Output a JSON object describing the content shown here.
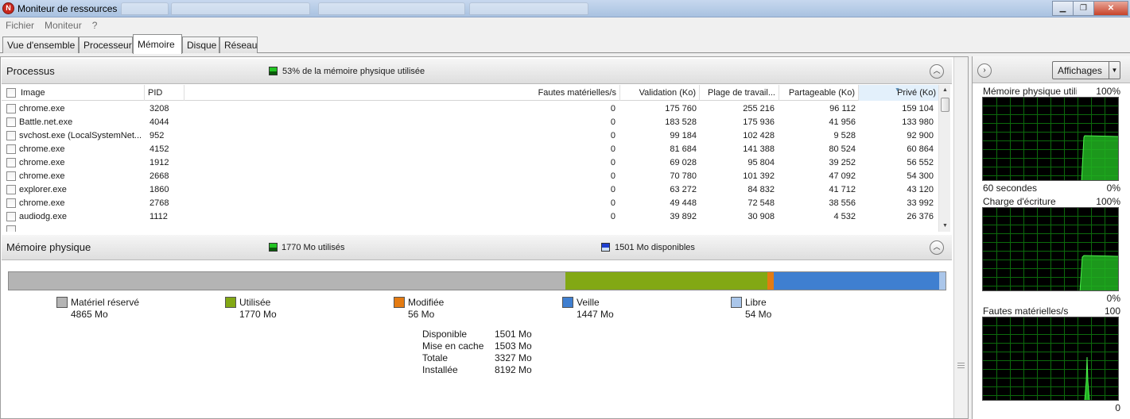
{
  "window": {
    "title": "Moniteur de ressources",
    "app_icon": "resource-monitor-icon",
    "controls": [
      "minimize",
      "restore",
      "close"
    ]
  },
  "menu": [
    "Fichier",
    "Moniteur",
    "?"
  ],
  "tabs": [
    {
      "label": "Vue d'ensemble",
      "active": false
    },
    {
      "label": "Processeur",
      "active": false
    },
    {
      "label": "Mémoire",
      "active": true
    },
    {
      "label": "Disque",
      "active": false
    },
    {
      "label": "Réseau",
      "active": false
    }
  ],
  "processes": {
    "title": "Processus",
    "usage_text": "53% de la mémoire physique utilisée",
    "usage_color": "#22c422",
    "columns": [
      "Image",
      "PID",
      "Fautes matérielles/s",
      "Validation (Ko)",
      "Plage de travail...",
      "Partageable (Ko)",
      "Privé (Ko)"
    ],
    "sorted_column": "Privé (Ko)",
    "rows": [
      {
        "image": "chrome.exe",
        "pid": "3208",
        "faults": "0",
        "commit": "175 760",
        "working_set": "255 216",
        "shareable": "96 112",
        "private": "159 104"
      },
      {
        "image": "Battle.net.exe",
        "pid": "4044",
        "faults": "0",
        "commit": "183 528",
        "working_set": "175 936",
        "shareable": "41 956",
        "private": "133 980"
      },
      {
        "image": "svchost.exe (LocalSystemNet...",
        "pid": "952",
        "faults": "0",
        "commit": "99 184",
        "working_set": "102 428",
        "shareable": "9 528",
        "private": "92 900"
      },
      {
        "image": "chrome.exe",
        "pid": "4152",
        "faults": "0",
        "commit": "81 684",
        "working_set": "141 388",
        "shareable": "80 524",
        "private": "60 864"
      },
      {
        "image": "chrome.exe",
        "pid": "1912",
        "faults": "0",
        "commit": "69 028",
        "working_set": "95 804",
        "shareable": "39 252",
        "private": "56 552"
      },
      {
        "image": "chrome.exe",
        "pid": "2668",
        "faults": "0",
        "commit": "70 780",
        "working_set": "101 392",
        "shareable": "47 092",
        "private": "54 300"
      },
      {
        "image": "explorer.exe",
        "pid": "1860",
        "faults": "0",
        "commit": "63 272",
        "working_set": "84 832",
        "shareable": "41 712",
        "private": "43 120"
      },
      {
        "image": "chrome.exe",
        "pid": "2768",
        "faults": "0",
        "commit": "49 448",
        "working_set": "72 548",
        "shareable": "38 556",
        "private": "33 992"
      },
      {
        "image": "audiodg.exe",
        "pid": "1112",
        "faults": "0",
        "commit": "39 892",
        "working_set": "30 908",
        "shareable": "4 532",
        "private": "26 376"
      }
    ]
  },
  "physical_memory": {
    "title": "Mémoire physique",
    "used_text": "1770 Mo utilisés",
    "used_color": "#22c422",
    "available_text": "1501 Mo disponibles",
    "available_color": "#1f3fd0",
    "legend": [
      {
        "label": "Matériel réservé",
        "value": "4865 Mo",
        "color": "#b4b4b4",
        "mb": 4865
      },
      {
        "label": "Utilisée",
        "value": "1770 Mo",
        "color": "#82a814",
        "mb": 1770
      },
      {
        "label": "Modifiée",
        "value": "56 Mo",
        "color": "#e47b12",
        "mb": 56
      },
      {
        "label": "Veille",
        "value": "1447 Mo",
        "color": "#3f7fd0",
        "mb": 1447
      },
      {
        "label": "Libre",
        "value": "54 Mo",
        "color": "#aac6ea",
        "mb": 54
      }
    ],
    "stats": [
      {
        "label": "Disponible",
        "value": "1501 Mo"
      },
      {
        "label": "Mise en cache",
        "value": "1503 Mo"
      },
      {
        "label": "Totale",
        "value": "3327 Mo"
      },
      {
        "label": "Installée",
        "value": "8192 Mo"
      }
    ]
  },
  "right_panel": {
    "views_label": "Affichages",
    "graphs": [
      {
        "title": "Mémoire physique utili...",
        "max": "100%",
        "footer_left": "60 secondes",
        "footer_right": "0%"
      },
      {
        "title": "Charge d'écriture",
        "max": "100%",
        "footer_left": "",
        "footer_right": "0%"
      },
      {
        "title": "Fautes matérielles/s",
        "max": "100",
        "footer_left": "",
        "footer_right": "0"
      }
    ]
  }
}
